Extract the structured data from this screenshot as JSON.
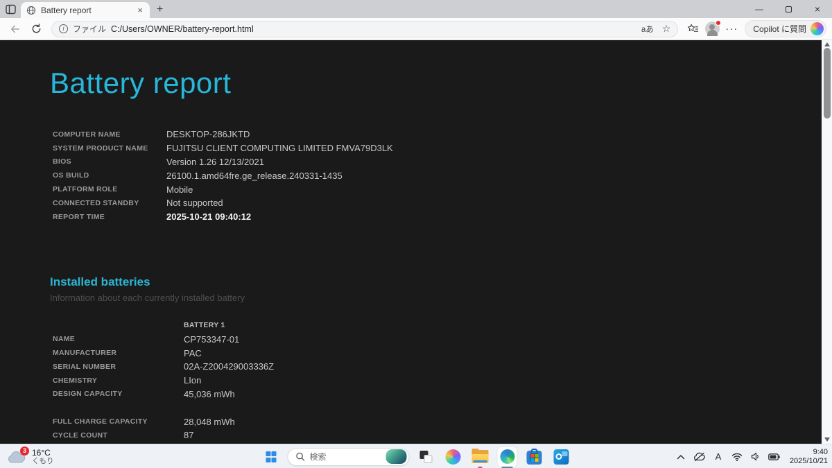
{
  "browser": {
    "tab_title": "Battery report",
    "new_tab_glyph": "+",
    "close_tab_glyph": "×",
    "minimize_glyph": "—",
    "close_window_glyph": "×",
    "more_glyph": "···",
    "translate_label": "aあ",
    "favorite_glyph": "☆",
    "info_glyph": "i",
    "address": {
      "scheme": "ファイル",
      "url": "C:/Users/OWNER/battery-report.html"
    },
    "copilot_button": "Copilot に質問"
  },
  "report": {
    "title": "Battery report",
    "accent_color": "#28b7da",
    "background_color": "#1a1a1a",
    "system": {
      "rows": [
        {
          "label": "COMPUTER NAME",
          "value": "DESKTOP-286JKTD"
        },
        {
          "label": "SYSTEM PRODUCT NAME",
          "value": "FUJITSU CLIENT COMPUTING LIMITED FMVA79D3LK"
        },
        {
          "label": "BIOS",
          "value": "Version 1.26 12/13/2021"
        },
        {
          "label": "OS BUILD",
          "value": "26100.1.amd64fre.ge_release.240331-1435"
        },
        {
          "label": "PLATFORM ROLE",
          "value": "Mobile"
        },
        {
          "label": "CONNECTED STANDBY",
          "value": "Not supported"
        },
        {
          "label": "REPORT TIME",
          "value": "2025-10-21  09:40:12"
        }
      ]
    },
    "batteries": {
      "heading": "Installed batteries",
      "subtitle": "Information about each currently installed battery",
      "column_header": "BATTERY 1",
      "rows": [
        {
          "label": "NAME",
          "value": "CP753347-01"
        },
        {
          "label": "MANUFACTURER",
          "value": "PAC"
        },
        {
          "label": "SERIAL NUMBER",
          "value": "02A-Z200429003336Z"
        },
        {
          "label": "CHEMISTRY",
          "value": "LIon"
        },
        {
          "label": "DESIGN CAPACITY",
          "value": "45,036 mWh"
        }
      ],
      "rows_secondary": [
        {
          "label": "FULL CHARGE CAPACITY",
          "value": "28,048 mWh"
        },
        {
          "label": "CYCLE COUNT",
          "value": "87"
        }
      ]
    }
  },
  "taskbar": {
    "weather": {
      "badge": "3",
      "temperature": "16°C",
      "condition": "くもり"
    },
    "search": {
      "placeholder": "検索"
    },
    "tray": {
      "ime_mode": "A",
      "time": "9:40",
      "date": "2025/10/21"
    }
  }
}
